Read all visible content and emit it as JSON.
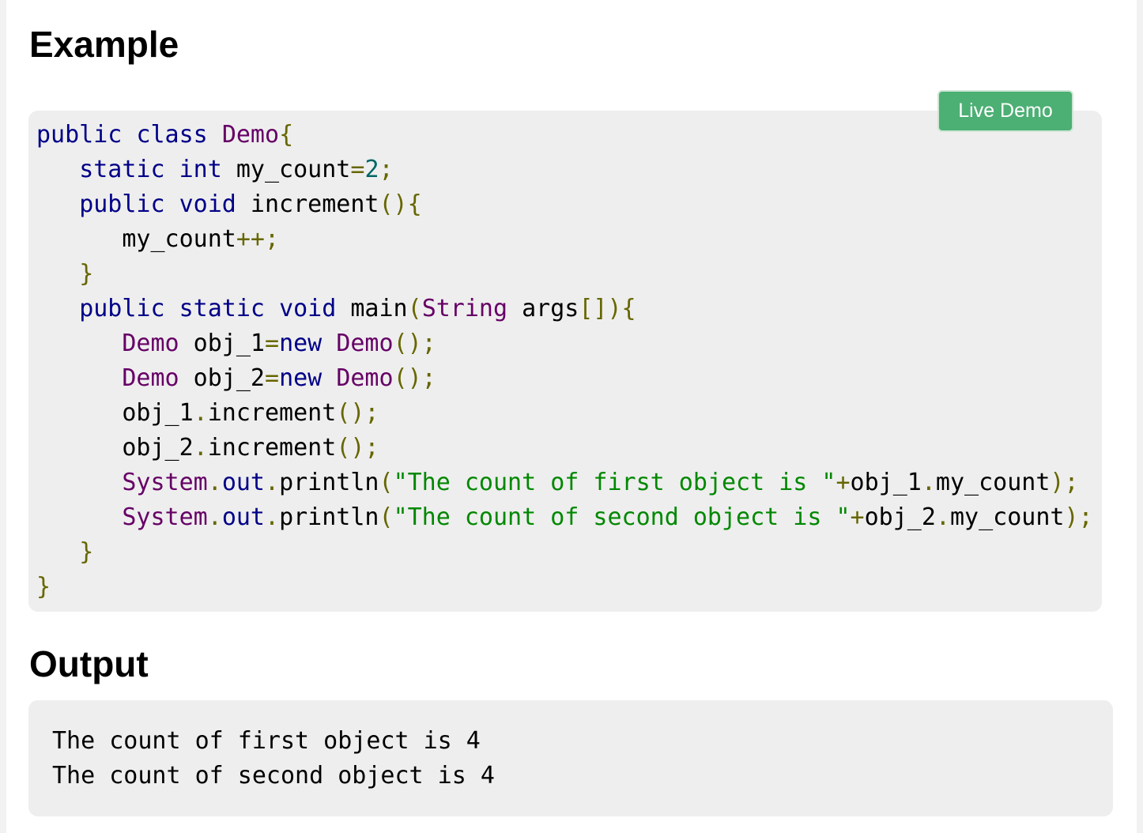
{
  "example_heading": "Example",
  "live_demo_label": "Live Demo",
  "output_heading": "Output",
  "colors": {
    "keyword": "#000088",
    "type": "#660066",
    "punctuation": "#666600",
    "literal": "#006666",
    "string": "#008800",
    "button": "#4caf74",
    "code_background": "#eeeeee"
  },
  "code_lines": [
    [
      [
        "kw",
        "public"
      ],
      [
        "pln",
        " "
      ],
      [
        "kw",
        "class"
      ],
      [
        "pln",
        " "
      ],
      [
        "typ",
        "Demo"
      ],
      [
        "pun",
        "{"
      ]
    ],
    [
      [
        "pln",
        "   "
      ],
      [
        "kw",
        "static"
      ],
      [
        "pln",
        " "
      ],
      [
        "kw",
        "int"
      ],
      [
        "pln",
        " my_count"
      ],
      [
        "pun",
        "="
      ],
      [
        "lit",
        "2"
      ],
      [
        "pun",
        ";"
      ]
    ],
    [
      [
        "pln",
        "   "
      ],
      [
        "kw",
        "public"
      ],
      [
        "pln",
        " "
      ],
      [
        "kw",
        "void"
      ],
      [
        "pln",
        " increment"
      ],
      [
        "pun",
        "(){"
      ]
    ],
    [
      [
        "pln",
        "      my_count"
      ],
      [
        "pun",
        "++;"
      ]
    ],
    [
      [
        "pln",
        "   "
      ],
      [
        "pun",
        "}"
      ]
    ],
    [
      [
        "pln",
        "   "
      ],
      [
        "kw",
        "public"
      ],
      [
        "pln",
        " "
      ],
      [
        "kw",
        "static"
      ],
      [
        "pln",
        " "
      ],
      [
        "kw",
        "void"
      ],
      [
        "pln",
        " main"
      ],
      [
        "pun",
        "("
      ],
      [
        "typ",
        "String"
      ],
      [
        "pln",
        " args"
      ],
      [
        "pun",
        "[]){"
      ]
    ],
    [
      [
        "pln",
        "      "
      ],
      [
        "typ",
        "Demo"
      ],
      [
        "pln",
        " obj_1"
      ],
      [
        "pun",
        "="
      ],
      [
        "kw",
        "new"
      ],
      [
        "pln",
        " "
      ],
      [
        "typ",
        "Demo"
      ],
      [
        "pun",
        "();"
      ]
    ],
    [
      [
        "pln",
        "      "
      ],
      [
        "typ",
        "Demo"
      ],
      [
        "pln",
        " obj_2"
      ],
      [
        "pun",
        "="
      ],
      [
        "kw",
        "new"
      ],
      [
        "pln",
        " "
      ],
      [
        "typ",
        "Demo"
      ],
      [
        "pun",
        "();"
      ]
    ],
    [
      [
        "pln",
        "      obj_1"
      ],
      [
        "pun",
        "."
      ],
      [
        "pln",
        "increment"
      ],
      [
        "pun",
        "();"
      ]
    ],
    [
      [
        "pln",
        "      obj_2"
      ],
      [
        "pun",
        "."
      ],
      [
        "pln",
        "increment"
      ],
      [
        "pun",
        "();"
      ]
    ],
    [
      [
        "pln",
        "      "
      ],
      [
        "typ",
        "System"
      ],
      [
        "pun",
        "."
      ],
      [
        "kw",
        "out"
      ],
      [
        "pun",
        "."
      ],
      [
        "pln",
        "println"
      ],
      [
        "pun",
        "("
      ],
      [
        "str",
        "\"The count of first object is \""
      ],
      [
        "pun",
        "+"
      ],
      [
        "pln",
        "obj_1"
      ],
      [
        "pun",
        "."
      ],
      [
        "pln",
        "my_count"
      ],
      [
        "pun",
        ");"
      ]
    ],
    [
      [
        "pln",
        "      "
      ],
      [
        "typ",
        "System"
      ],
      [
        "pun",
        "."
      ],
      [
        "kw",
        "out"
      ],
      [
        "pun",
        "."
      ],
      [
        "pln",
        "println"
      ],
      [
        "pun",
        "("
      ],
      [
        "str",
        "\"The count of second object is \""
      ],
      [
        "pun",
        "+"
      ],
      [
        "pln",
        "obj_2"
      ],
      [
        "pun",
        "."
      ],
      [
        "pln",
        "my_count"
      ],
      [
        "pun",
        ");"
      ]
    ],
    [
      [
        "pln",
        "   "
      ],
      [
        "pun",
        "}"
      ]
    ],
    [
      [
        "pun",
        "}"
      ]
    ]
  ],
  "output_lines": [
    "The count of first object is 4",
    "The count of second object is 4"
  ]
}
